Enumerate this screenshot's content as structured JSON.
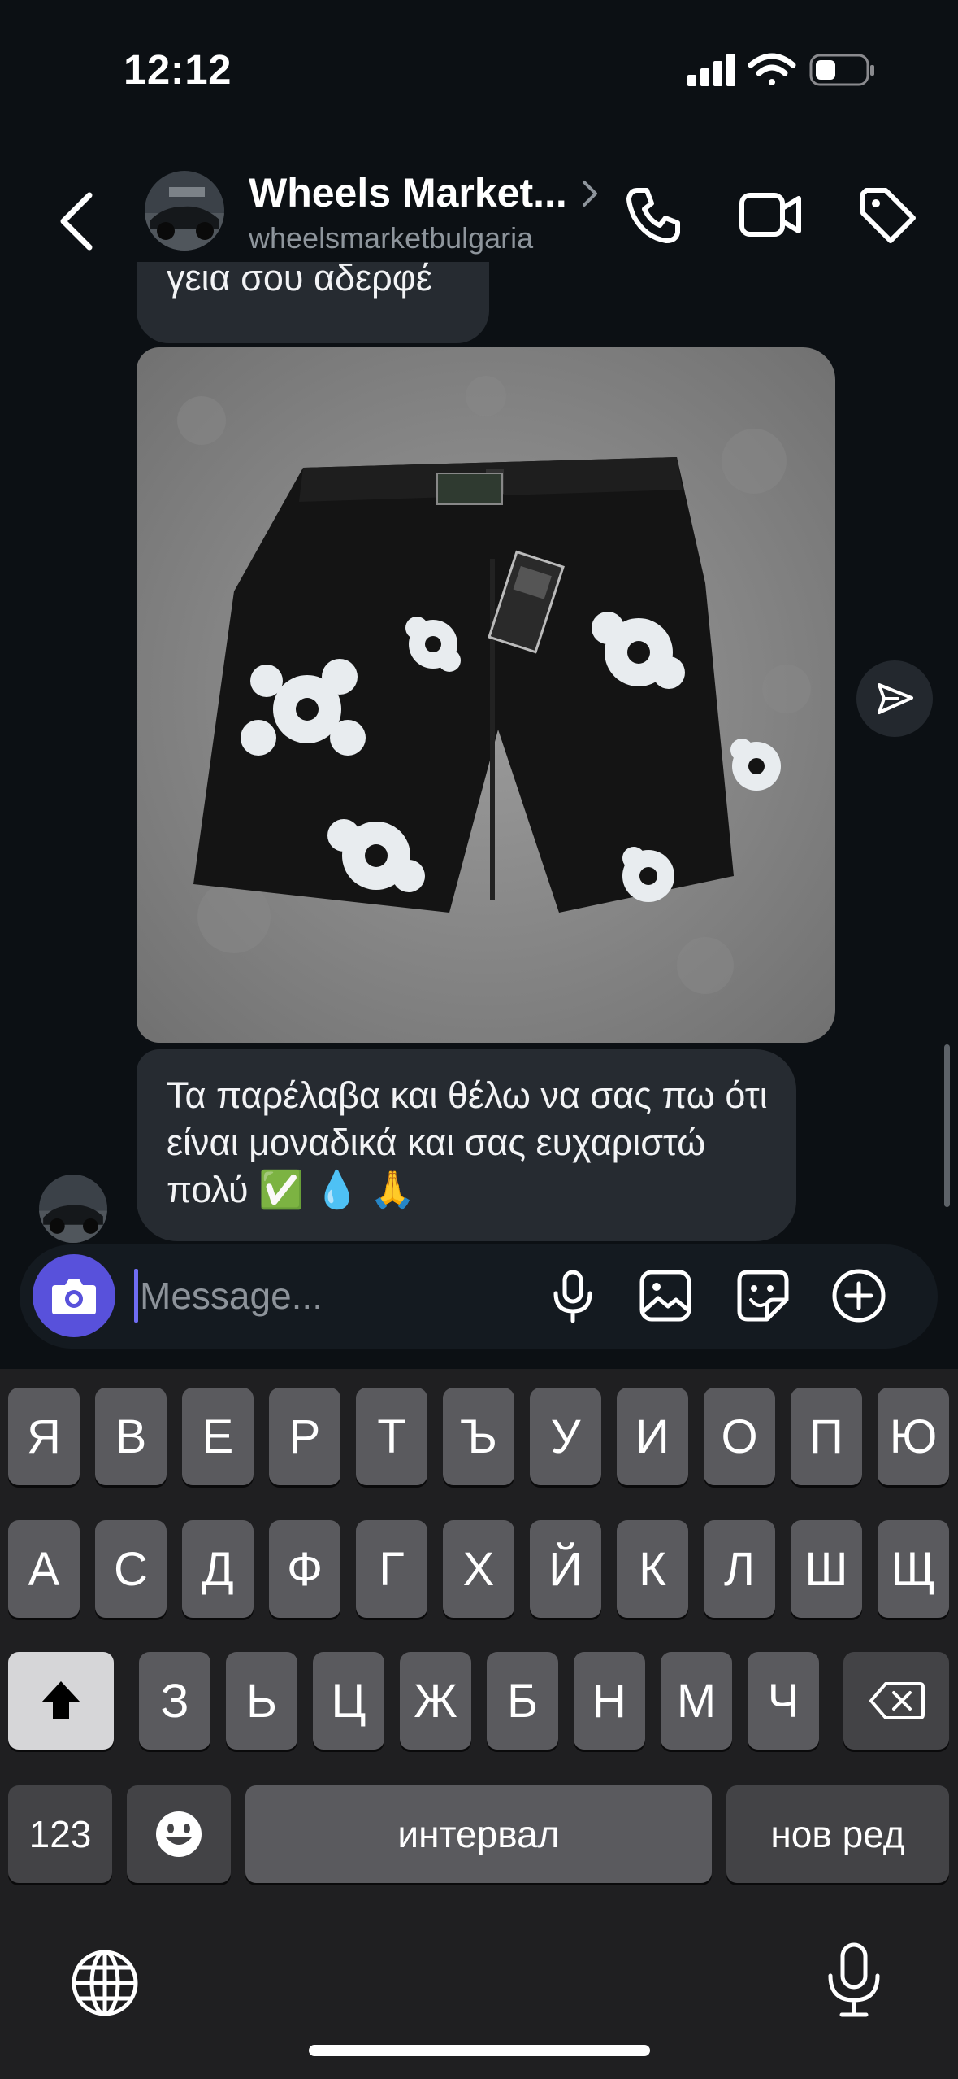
{
  "status_bar": {
    "time": "12:12"
  },
  "header": {
    "contact_name": "Wheels Market...",
    "contact_handle": "wheelsmarketbulgaria"
  },
  "messages": [
    {
      "text": "γεια σου αδερφέ"
    },
    {
      "type": "image"
    },
    {
      "text": "Τα παρέλαβα και θέλω να σας πω ότι είναι μοναδικά και σας ευχαριστώ πολύ ✅ 💧 🙏"
    }
  ],
  "composer": {
    "placeholder": "Message..."
  },
  "keyboard": {
    "row1": [
      "Я",
      "В",
      "Е",
      "Р",
      "Т",
      "Ъ",
      "У",
      "И",
      "О",
      "П",
      "Ю"
    ],
    "row2": [
      "А",
      "С",
      "Д",
      "Ф",
      "Г",
      "Х",
      "Й",
      "К",
      "Л",
      "Ш",
      "Щ"
    ],
    "row3": [
      "З",
      "Ь",
      "Ц",
      "Ж",
      "Б",
      "Н",
      "М",
      "Ч"
    ],
    "numbers_label": "123",
    "space_label": "интервал",
    "return_label": "нов ред"
  },
  "colors": {
    "background": "#0c1014",
    "bubble": "#262b31",
    "camera_button": "#5851db",
    "keyboard_bg": "#1f1f21",
    "key": "#5a5a5e"
  }
}
